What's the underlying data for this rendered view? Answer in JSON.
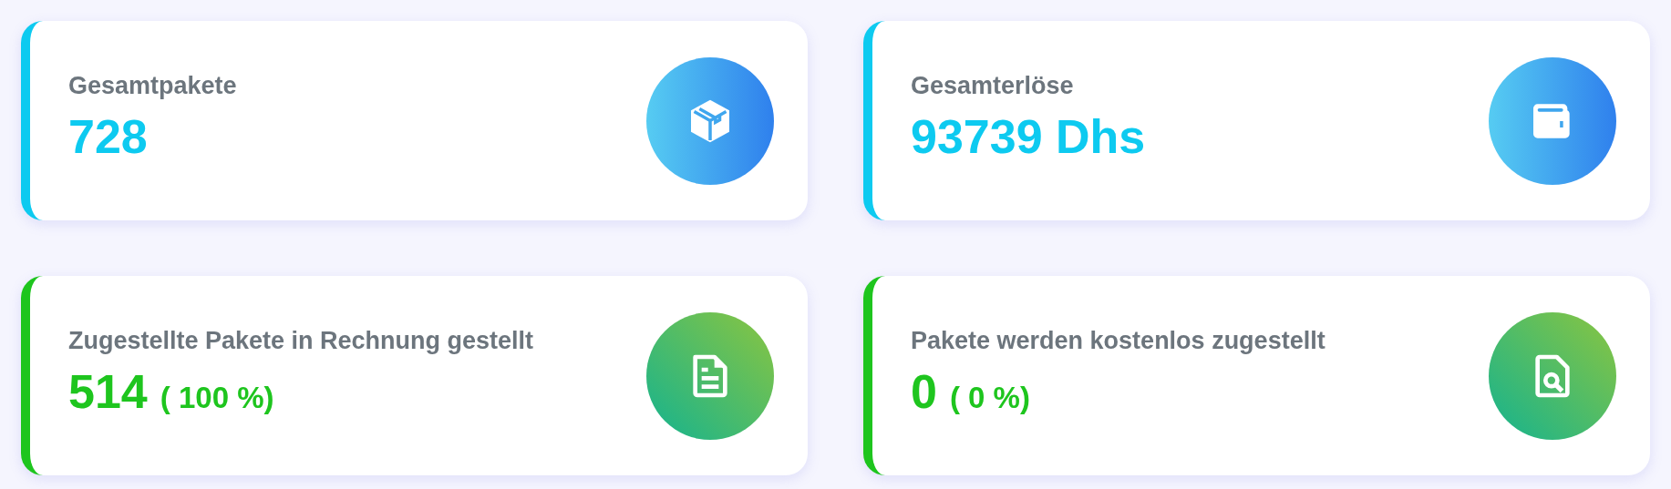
{
  "cards": [
    {
      "title": "Gesamtpakete",
      "value": "728",
      "color": "#0dcaf0",
      "kind": "box"
    },
    {
      "title": "Gesamterlöse",
      "value": "93739 Dhs",
      "color": "#0dcaf0",
      "kind": "wallet"
    },
    {
      "title": "Zugestellte Pakete in Rechnung gestellt",
      "value": "514",
      "percent": "( 100 %)",
      "color": "#1ec51e",
      "kind": "invoice"
    },
    {
      "title": "Pakete werden kostenlos zugestellt",
      "value": "0",
      "percent": "( 0 %)",
      "color": "#1ec51e",
      "kind": "search"
    }
  ]
}
